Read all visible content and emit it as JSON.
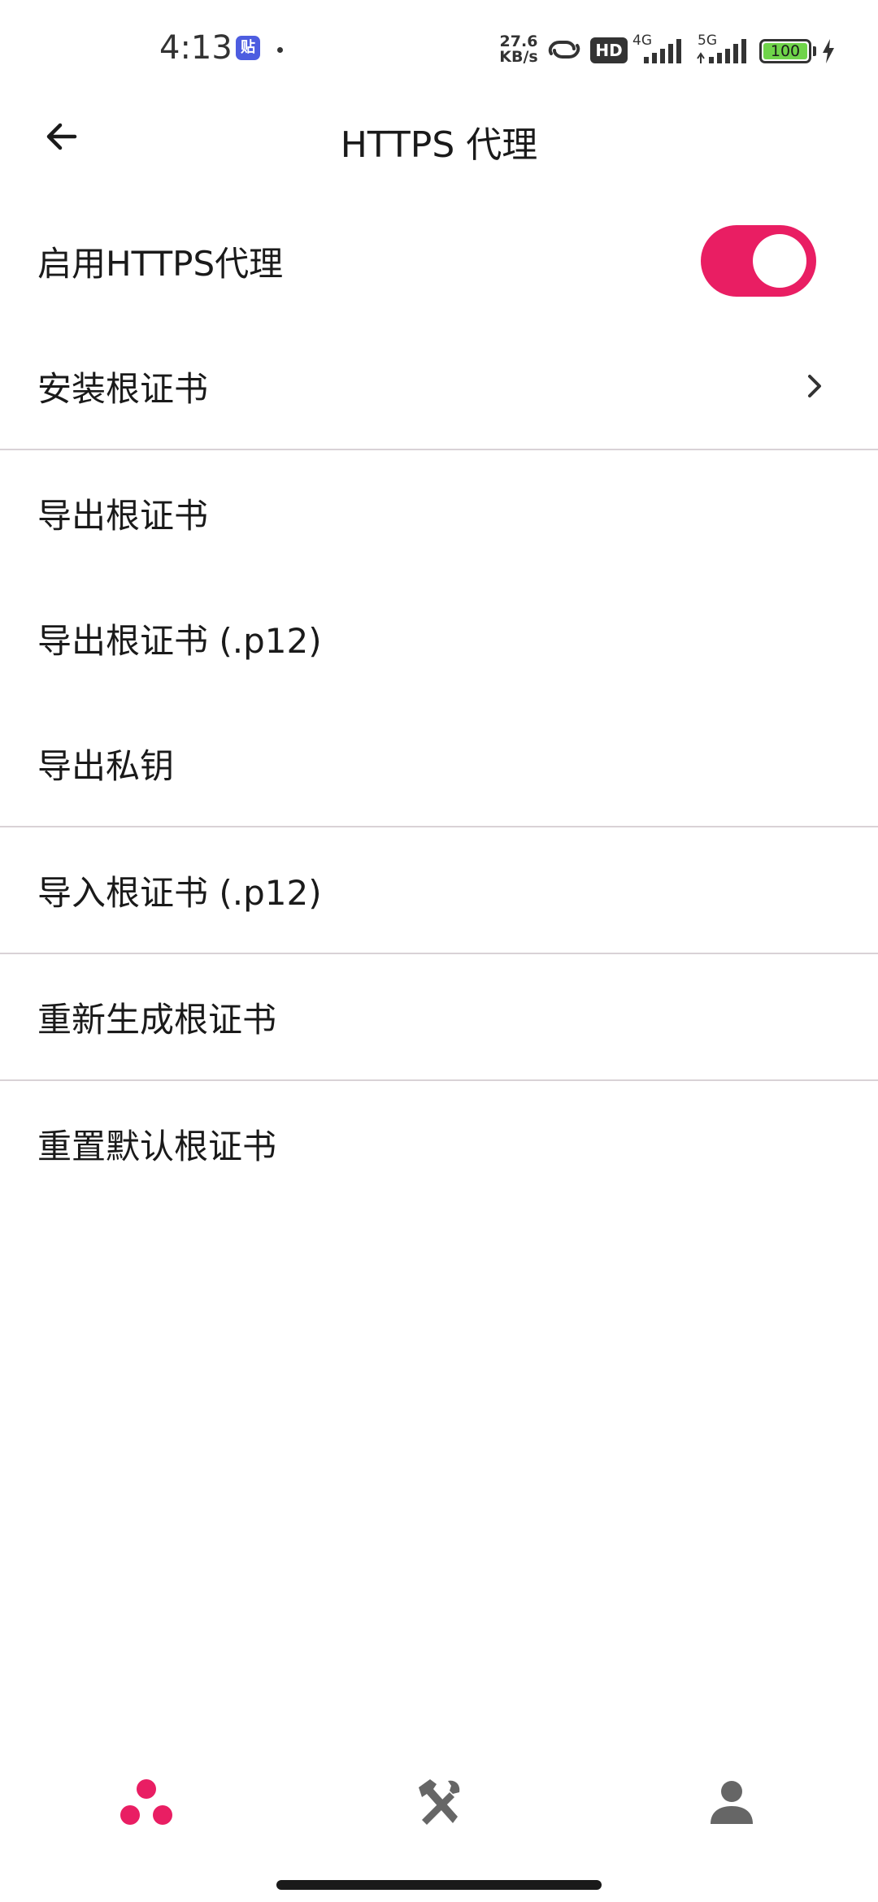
{
  "status_bar": {
    "time": "4:13",
    "app_icon_glyph": "贴",
    "net_speed_value": "27.6",
    "net_speed_unit": "KB/s",
    "hd_label": "HD",
    "net1_label": "4G",
    "net2_label": "5G",
    "battery_level": "100"
  },
  "app_bar": {
    "back_icon": "arrow-back-icon",
    "title": "HTTPS 代理"
  },
  "settings": {
    "enable_https_proxy": {
      "label": "启用HTTPS代理",
      "enabled": true
    },
    "install_root_cert": {
      "label": "安装根证书"
    },
    "export_root_cert": {
      "label": "导出根证书"
    },
    "export_root_cert_p12": {
      "label": "导出根证书 (.p12)"
    },
    "export_private_key": {
      "label": "导出私钥"
    },
    "import_root_cert_p12": {
      "label": "导入根证书 (.p12)"
    },
    "regenerate_root_cert": {
      "label": "重新生成根证书"
    },
    "reset_default_root_cert": {
      "label": "重置默认根证书"
    }
  },
  "bottom_nav": {
    "items": [
      {
        "icon": "bubbles-icon",
        "active": true
      },
      {
        "icon": "tools-icon",
        "active": false
      },
      {
        "icon": "person-icon",
        "active": false
      }
    ]
  },
  "colors": {
    "accent": "#e91e63",
    "text": "#1a1a1a",
    "divider": "#d9d2d6",
    "icon_gray": "#666666"
  }
}
